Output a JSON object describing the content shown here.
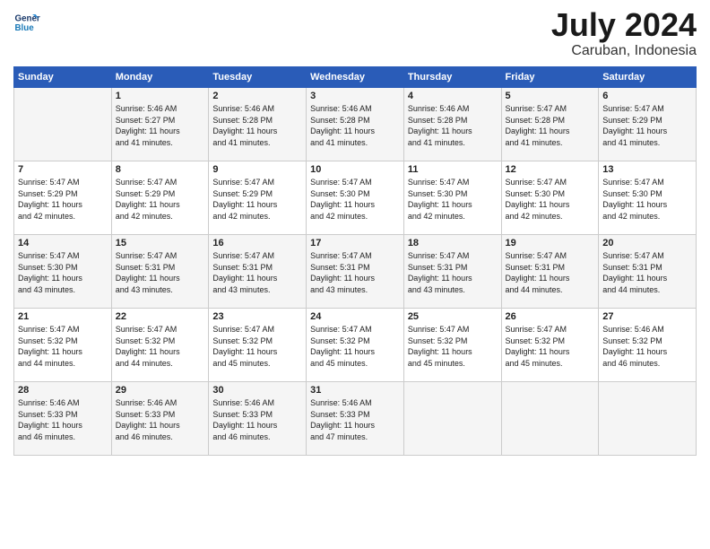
{
  "header": {
    "logo_line1": "General",
    "logo_line2": "Blue",
    "month": "July 2024",
    "location": "Caruban, Indonesia"
  },
  "columns": [
    "Sunday",
    "Monday",
    "Tuesday",
    "Wednesday",
    "Thursday",
    "Friday",
    "Saturday"
  ],
  "weeks": [
    [
      {
        "day": "",
        "info": ""
      },
      {
        "day": "1",
        "info": "Sunrise: 5:46 AM\nSunset: 5:27 PM\nDaylight: 11 hours\nand 41 minutes."
      },
      {
        "day": "2",
        "info": "Sunrise: 5:46 AM\nSunset: 5:28 PM\nDaylight: 11 hours\nand 41 minutes."
      },
      {
        "day": "3",
        "info": "Sunrise: 5:46 AM\nSunset: 5:28 PM\nDaylight: 11 hours\nand 41 minutes."
      },
      {
        "day": "4",
        "info": "Sunrise: 5:46 AM\nSunset: 5:28 PM\nDaylight: 11 hours\nand 41 minutes."
      },
      {
        "day": "5",
        "info": "Sunrise: 5:47 AM\nSunset: 5:28 PM\nDaylight: 11 hours\nand 41 minutes."
      },
      {
        "day": "6",
        "info": "Sunrise: 5:47 AM\nSunset: 5:29 PM\nDaylight: 11 hours\nand 41 minutes."
      }
    ],
    [
      {
        "day": "7",
        "info": "Sunrise: 5:47 AM\nSunset: 5:29 PM\nDaylight: 11 hours\nand 42 minutes."
      },
      {
        "day": "8",
        "info": "Sunrise: 5:47 AM\nSunset: 5:29 PM\nDaylight: 11 hours\nand 42 minutes."
      },
      {
        "day": "9",
        "info": "Sunrise: 5:47 AM\nSunset: 5:29 PM\nDaylight: 11 hours\nand 42 minutes."
      },
      {
        "day": "10",
        "info": "Sunrise: 5:47 AM\nSunset: 5:30 PM\nDaylight: 11 hours\nand 42 minutes."
      },
      {
        "day": "11",
        "info": "Sunrise: 5:47 AM\nSunset: 5:30 PM\nDaylight: 11 hours\nand 42 minutes."
      },
      {
        "day": "12",
        "info": "Sunrise: 5:47 AM\nSunset: 5:30 PM\nDaylight: 11 hours\nand 42 minutes."
      },
      {
        "day": "13",
        "info": "Sunrise: 5:47 AM\nSunset: 5:30 PM\nDaylight: 11 hours\nand 42 minutes."
      }
    ],
    [
      {
        "day": "14",
        "info": "Sunrise: 5:47 AM\nSunset: 5:30 PM\nDaylight: 11 hours\nand 43 minutes."
      },
      {
        "day": "15",
        "info": "Sunrise: 5:47 AM\nSunset: 5:31 PM\nDaylight: 11 hours\nand 43 minutes."
      },
      {
        "day": "16",
        "info": "Sunrise: 5:47 AM\nSunset: 5:31 PM\nDaylight: 11 hours\nand 43 minutes."
      },
      {
        "day": "17",
        "info": "Sunrise: 5:47 AM\nSunset: 5:31 PM\nDaylight: 11 hours\nand 43 minutes."
      },
      {
        "day": "18",
        "info": "Sunrise: 5:47 AM\nSunset: 5:31 PM\nDaylight: 11 hours\nand 43 minutes."
      },
      {
        "day": "19",
        "info": "Sunrise: 5:47 AM\nSunset: 5:31 PM\nDaylight: 11 hours\nand 44 minutes."
      },
      {
        "day": "20",
        "info": "Sunrise: 5:47 AM\nSunset: 5:31 PM\nDaylight: 11 hours\nand 44 minutes."
      }
    ],
    [
      {
        "day": "21",
        "info": "Sunrise: 5:47 AM\nSunset: 5:32 PM\nDaylight: 11 hours\nand 44 minutes."
      },
      {
        "day": "22",
        "info": "Sunrise: 5:47 AM\nSunset: 5:32 PM\nDaylight: 11 hours\nand 44 minutes."
      },
      {
        "day": "23",
        "info": "Sunrise: 5:47 AM\nSunset: 5:32 PM\nDaylight: 11 hours\nand 45 minutes."
      },
      {
        "day": "24",
        "info": "Sunrise: 5:47 AM\nSunset: 5:32 PM\nDaylight: 11 hours\nand 45 minutes."
      },
      {
        "day": "25",
        "info": "Sunrise: 5:47 AM\nSunset: 5:32 PM\nDaylight: 11 hours\nand 45 minutes."
      },
      {
        "day": "26",
        "info": "Sunrise: 5:47 AM\nSunset: 5:32 PM\nDaylight: 11 hours\nand 45 minutes."
      },
      {
        "day": "27",
        "info": "Sunrise: 5:46 AM\nSunset: 5:32 PM\nDaylight: 11 hours\nand 46 minutes."
      }
    ],
    [
      {
        "day": "28",
        "info": "Sunrise: 5:46 AM\nSunset: 5:33 PM\nDaylight: 11 hours\nand 46 minutes."
      },
      {
        "day": "29",
        "info": "Sunrise: 5:46 AM\nSunset: 5:33 PM\nDaylight: 11 hours\nand 46 minutes."
      },
      {
        "day": "30",
        "info": "Sunrise: 5:46 AM\nSunset: 5:33 PM\nDaylight: 11 hours\nand 46 minutes."
      },
      {
        "day": "31",
        "info": "Sunrise: 5:46 AM\nSunset: 5:33 PM\nDaylight: 11 hours\nand 47 minutes."
      },
      {
        "day": "",
        "info": ""
      },
      {
        "day": "",
        "info": ""
      },
      {
        "day": "",
        "info": ""
      }
    ]
  ]
}
